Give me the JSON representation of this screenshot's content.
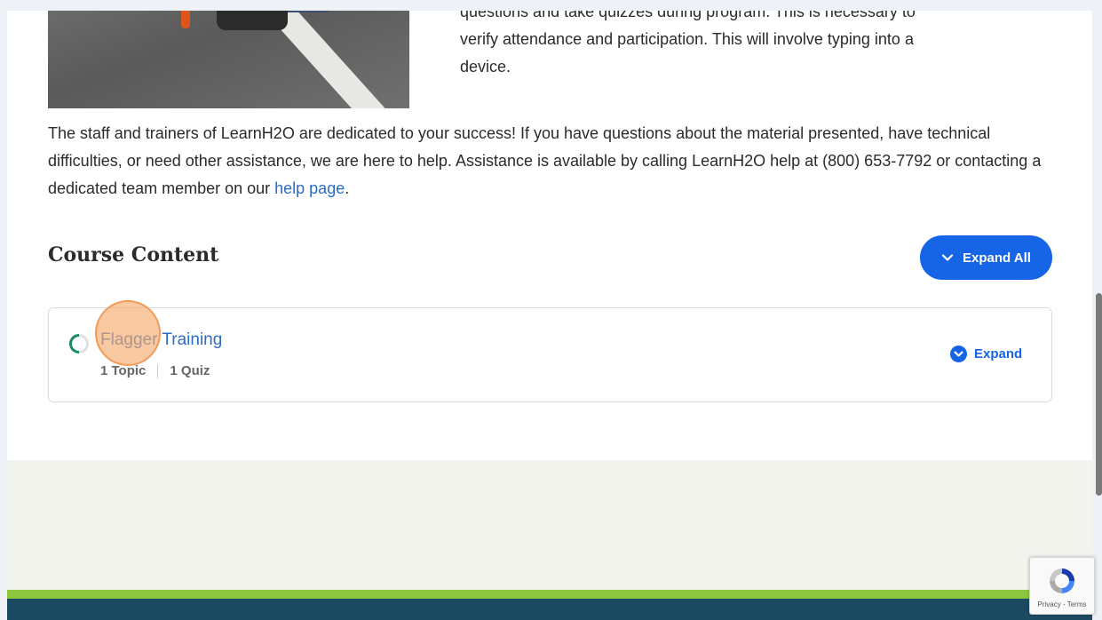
{
  "intro": {
    "lines": [
      "questions and take quizzes during program. This is necessary to",
      "verify attendance and participation. This will involve typing into a",
      "device."
    ]
  },
  "staff": {
    "text": "The staff and trainers of LearnH2O are dedicated to your success! If you have questions about the material presented, have technical difficulties, or need other assistance, we are here to help. Assistance is available by calling LearnH2O help at (800) 653-7792 or contacting a dedicated team member on our ",
    "link": "help page",
    "end": "."
  },
  "course_content": {
    "title": "Course Content",
    "expand_all_label": "Expand All",
    "lesson": {
      "title": "Flagger Training",
      "topics": "1 Topic",
      "quizzes": "1 Quiz",
      "expand_label": "Expand"
    }
  },
  "recaptcha": {
    "terms": "Privacy - Terms"
  },
  "colors": {
    "accent": "#1565e6",
    "link": "#2b6cc4",
    "footer_green": "#8cc63f",
    "footer_dark": "#1d4a63"
  }
}
